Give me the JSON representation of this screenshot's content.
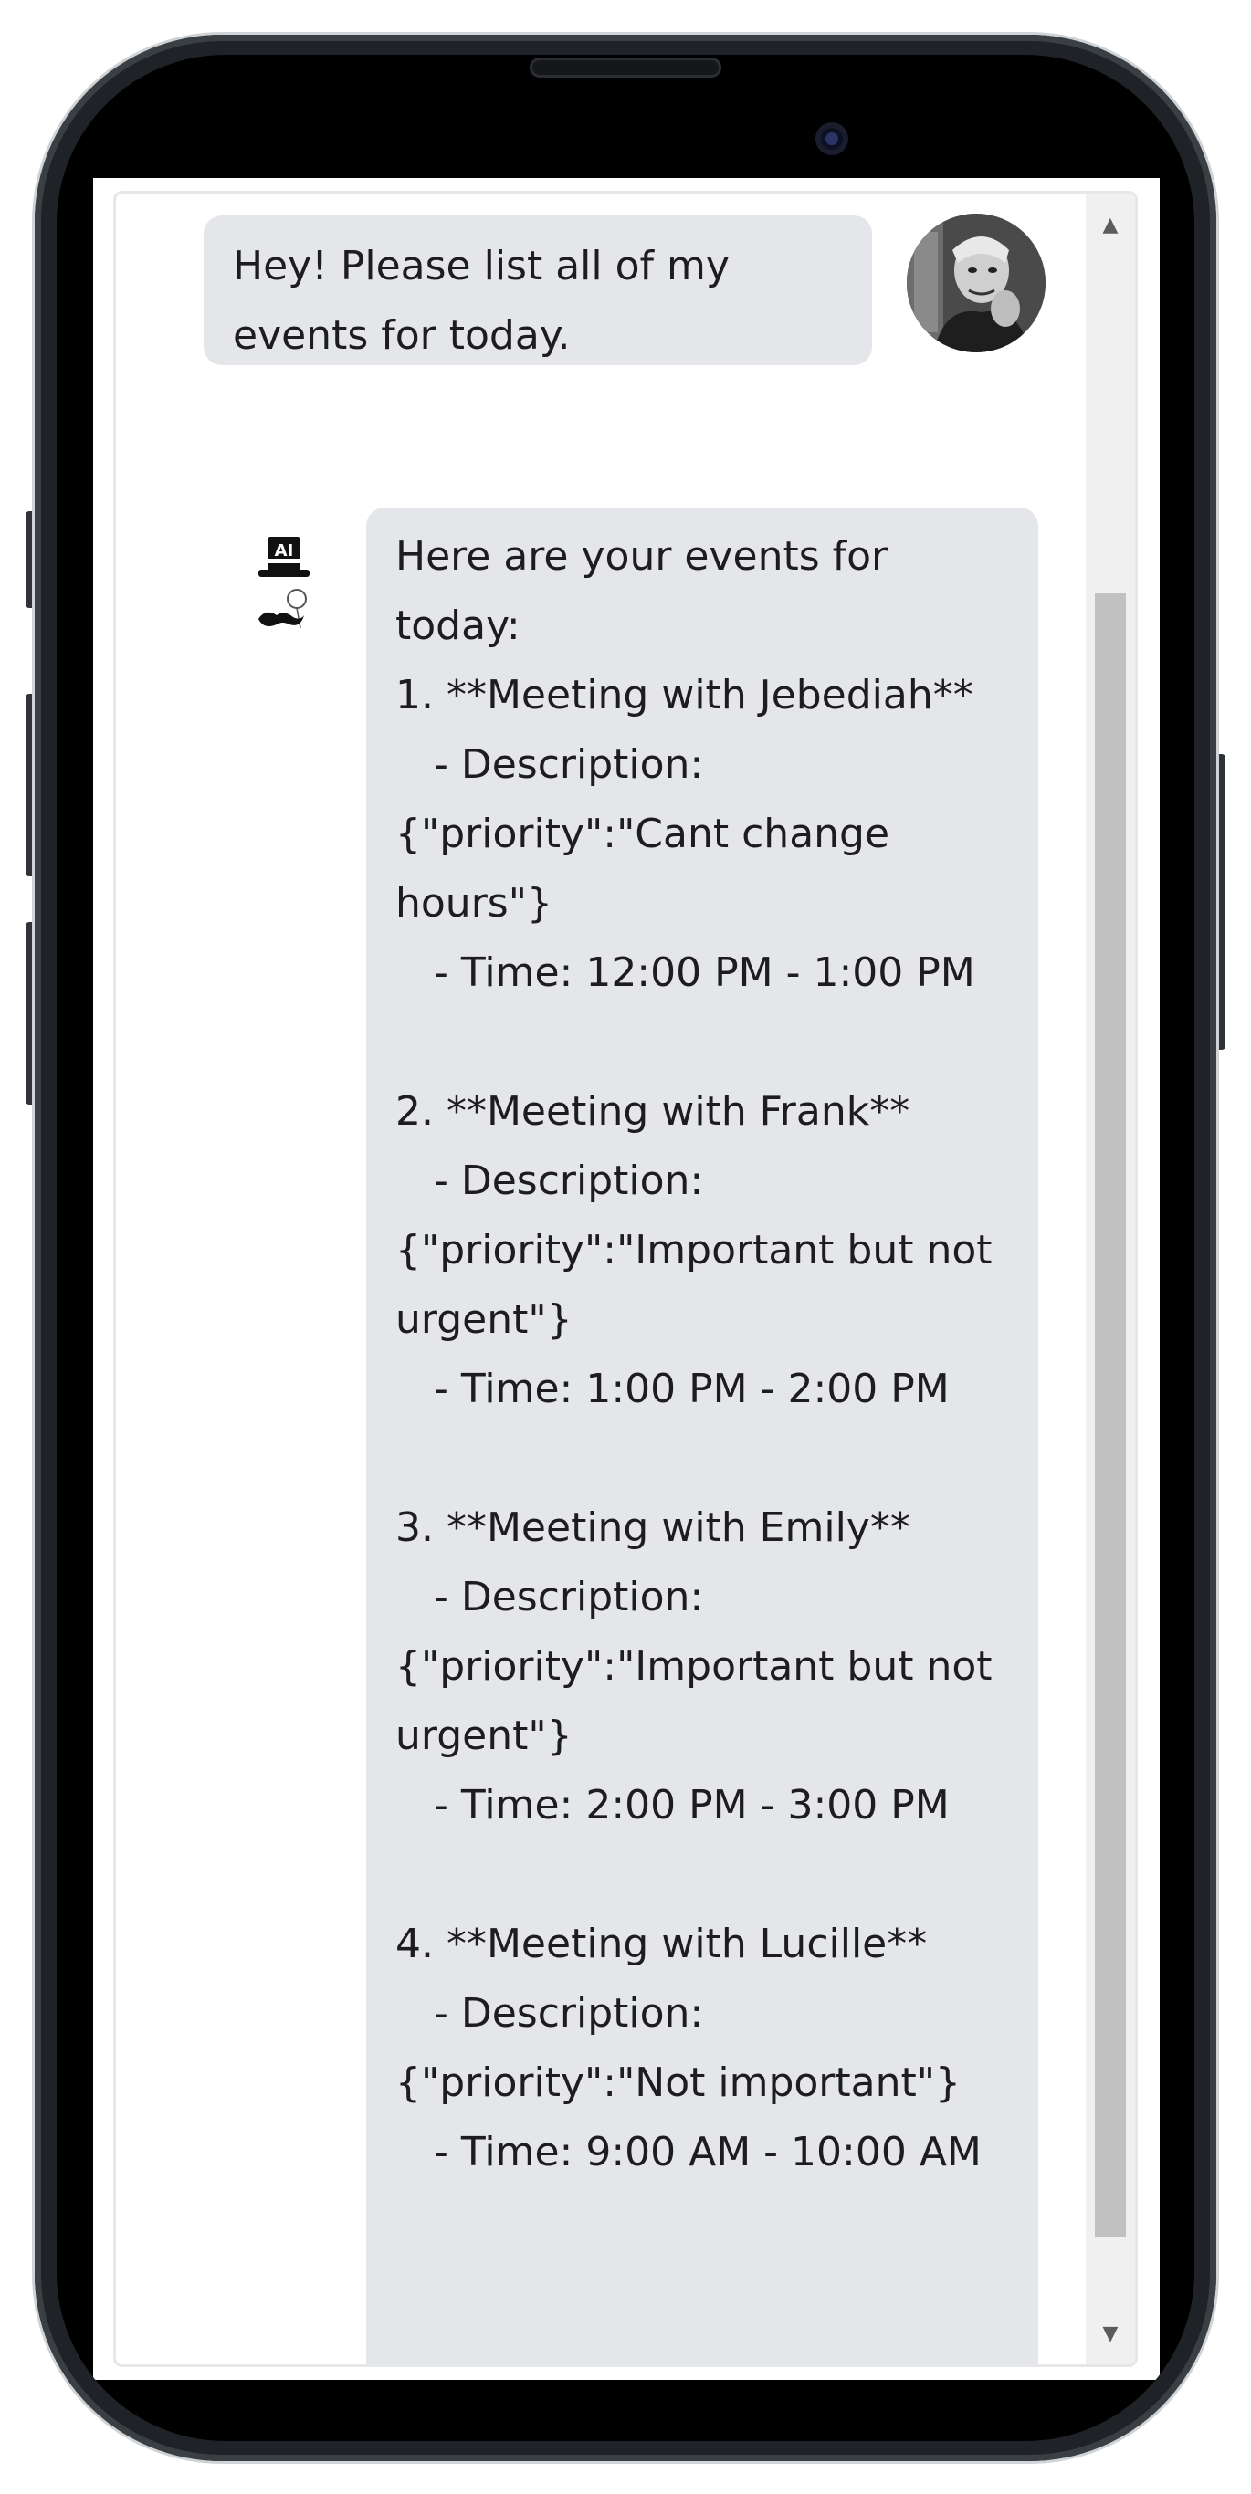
{
  "chat": {
    "user_message": "Hey! Please list all of my events for today.",
    "bot_message": "Here are your events for today:\n1. **Meeting with Jebediah**\n   - Description: {\"priority\":\"Cant change hours\"}\n   - Time: 12:00 PM - 1:00 PM\n\n2. **Meeting with Frank**\n   - Description: {\"priority\":\"Important but not urgent\"}\n   - Time: 1:00 PM - 2:00 PM\n\n3. **Meeting with Emily**\n   - Description: {\"priority\":\"Important but not urgent\"}\n   - Time: 2:00 PM - 3:00 PM\n\n4. **Meeting with Lucille**\n   - Description: {\"priority\":\"Not important\"}\n   - Time: 9:00 AM - 10:00 AM",
    "bot_avatar_text": "AI"
  },
  "icons": {
    "user_avatar": "user-avatar",
    "bot_avatar": "top-hat-monocle-icon",
    "scroll_up": "triangle-up-icon",
    "scroll_down": "triangle-down-icon"
  },
  "colors": {
    "bubble_bg": "#e5e6e9",
    "scroll_thumb": "#c1c1c1",
    "phone_frame": "#1f2226"
  }
}
